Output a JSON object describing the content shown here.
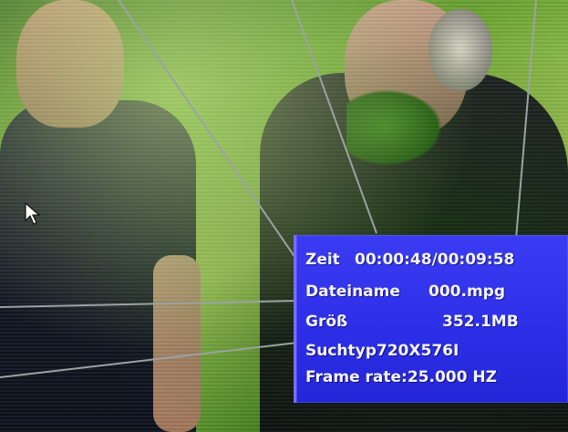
{
  "osd": {
    "time_label": "Zeit",
    "time_value": "00:00:48/00:09:58",
    "filename_label": "Dateiname",
    "filename_value": "000.mpg",
    "size_label": "Größ",
    "size_value": "352.1MB",
    "search_type": "Suchtyp720X576I",
    "frame_rate": "Frame rate:25.000 HZ"
  },
  "colors": {
    "osd_background": "#2f30e8",
    "osd_text": "#f4f4ff",
    "callout_lines": "#9aa3a3"
  },
  "icons": [
    "mouse-pointer-icon"
  ]
}
